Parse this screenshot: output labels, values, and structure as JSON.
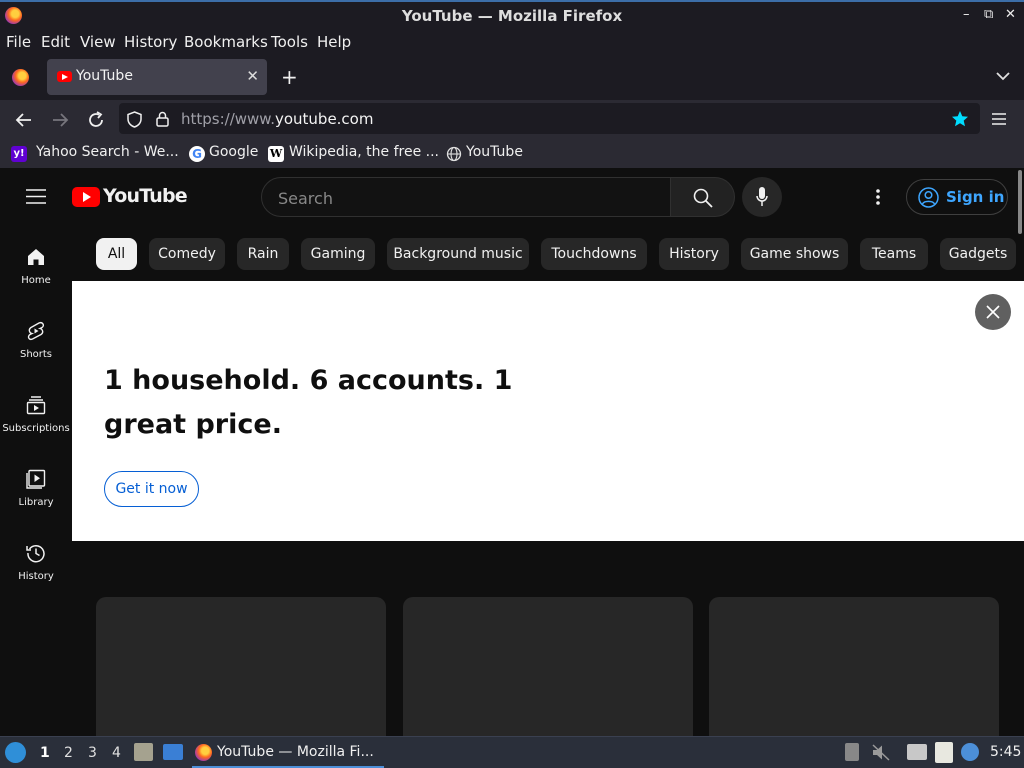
{
  "window": {
    "title": "YouTube — Mozilla Firefox"
  },
  "menu": [
    "File",
    "Edit",
    "View",
    "History",
    "Bookmarks",
    "Tools",
    "Help"
  ],
  "tab": {
    "title": "YouTube"
  },
  "url": {
    "prefix": "https://www.",
    "host": "youtube.com"
  },
  "bookmarks": [
    "Yahoo Search - We...",
    "Google",
    "Wikipedia, the free ...",
    "YouTube"
  ],
  "youtube": {
    "logo": "YouTube",
    "search_placeholder": "Search",
    "sign_in": "Sign in",
    "chips": [
      "All",
      "Comedy",
      "Rain",
      "Gaming",
      "Background music",
      "Touchdowns",
      "History",
      "Game shows",
      "Teams",
      "Gadgets"
    ],
    "sidebar": [
      "Home",
      "Shorts",
      "Subscriptions",
      "Library",
      "History"
    ],
    "banner": {
      "headline": "1 household. 6 accounts. 1 great price.",
      "cta": "Get it now"
    }
  },
  "taskbar": {
    "workspaces": [
      "1",
      "2",
      "3",
      "4"
    ],
    "active_task": "YouTube — Mozilla Fi...",
    "clock": "5:45"
  },
  "colors": {
    "accent_blue": "#3ea6ff",
    "youtube_red": "#ff0000",
    "cta_blue": "#065fd4"
  }
}
